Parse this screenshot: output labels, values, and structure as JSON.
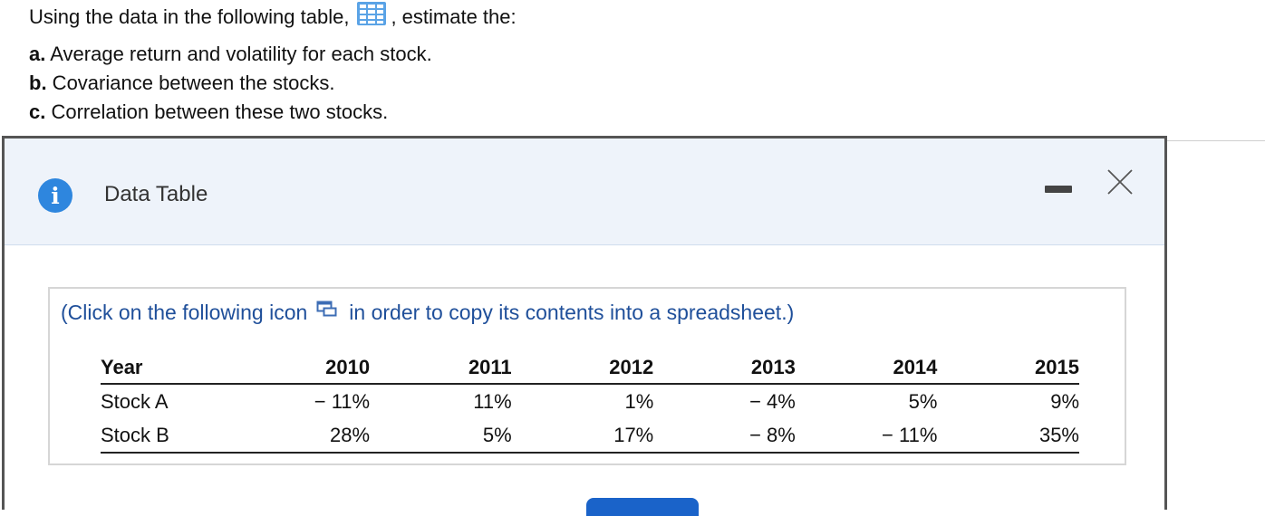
{
  "question": {
    "intro_before": "Using the data in the following table,",
    "intro_after": ", estimate the:",
    "items": [
      {
        "letter": "a.",
        "text": " Average return and volatility for each stock."
      },
      {
        "letter": "b.",
        "text": " Covariance between the stocks."
      },
      {
        "letter": "c.",
        "text": " Correlation between these two stocks."
      }
    ]
  },
  "dialog": {
    "title": "Data Table",
    "copy_note_before": "(Click on the following icon",
    "copy_note_after": "in order to copy its contents into a spreadsheet.)",
    "table": {
      "headers": [
        "Year",
        "2010",
        "2011",
        "2012",
        "2013",
        "2014",
        "2015"
      ],
      "rows": [
        [
          "Stock A",
          "− 11%",
          "11%",
          "1%",
          "− 4%",
          "5%",
          "9%"
        ],
        [
          "Stock B",
          "28%",
          "5%",
          "17%",
          "− 8%",
          "− 11%",
          "35%"
        ]
      ]
    }
  },
  "colors": {
    "accent": "#1a63c9",
    "info_icon": "#2e86de",
    "header_bg": "#eef3fa",
    "link_text": "#1f4f9a"
  },
  "icons": {
    "table_icon": "grid-table-icon",
    "info": "info-icon",
    "minimize": "minimize-icon",
    "close": "close-icon",
    "copy": "copy-to-spreadsheet-icon"
  }
}
